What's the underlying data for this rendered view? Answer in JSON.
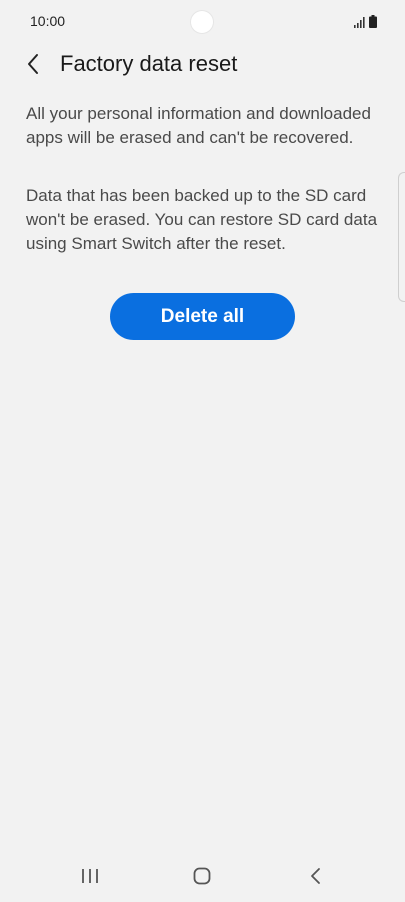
{
  "status_bar": {
    "time": "10:00"
  },
  "header": {
    "title": "Factory data reset",
    "back_icon": "chevron-left-icon"
  },
  "content": {
    "paragraph_1": "All your personal information and downloaded apps will be erased and can't be recovered.",
    "paragraph_2": "Data that has been backed up to the SD card won't be erased. You can restore SD card data using Smart Switch after the reset."
  },
  "actions": {
    "delete_label": "Delete all"
  },
  "nav_bar": {
    "recents_icon": "recents-icon",
    "home_icon": "home-icon",
    "back_icon": "back-icon"
  },
  "colors": {
    "background": "#f2f2f2",
    "accent": "#0a6fe0",
    "text_primary": "#1a1a1a",
    "text_secondary": "#4a4a4a"
  }
}
